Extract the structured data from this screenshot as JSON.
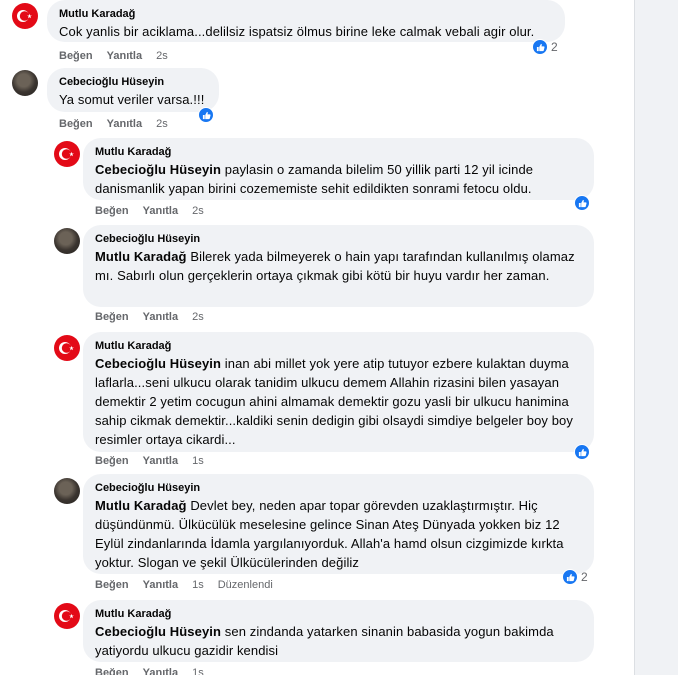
{
  "actions": {
    "like": "Beğen",
    "reply": "Yanıtla"
  },
  "comments": [
    {
      "author": "Mutlu Karadağ",
      "mention": "",
      "text": "Cok yanlis bir aciklama...delilsiz ispatsiz ölmus birine leke calmak vebali agir olur.",
      "time": "2s",
      "edited": "",
      "reactions": "2",
      "avatar": "flag"
    },
    {
      "author": "Cebecioğlu Hüseyin",
      "mention": "",
      "text": "Ya somut veriler varsa.!!!",
      "time": "2s",
      "edited": "",
      "reactions": "",
      "avatar": "photo"
    },
    {
      "author": "Mutlu Karadağ",
      "mention": "Cebecioğlu Hüseyin",
      "text": "paylasin o zamanda bilelim 50 yillik parti 12 yil icinde danismanlik yapan birini cozememiste sehit edildikten sonrami fetocu oldu.",
      "time": "2s",
      "edited": "",
      "reactions": "",
      "avatar": "flag"
    },
    {
      "author": "Cebecioğlu Hüseyin",
      "mention": "Mutlu Karadağ",
      "text": "Bilerek yada bilmeyerek o hain yapı tarafından kullanılmış olamaz mı. Sabırlı olun gerçeklerin ortaya çıkmak gibi kötü bir huyu vardır her zaman.",
      "time": "2s",
      "edited": "",
      "reactions": "",
      "avatar": "photo"
    },
    {
      "author": "Mutlu Karadağ",
      "mention": "Cebecioğlu Hüseyin",
      "text": "inan abi millet yok yere atip tutuyor ezbere kulaktan duyma laflarla...seni ulkucu olarak tanidim ulkucu demem Allahin rizasini bilen yasayan demektir 2 yetim cocugun ahini almamak demektir gozu yasli bir ulkucu hanimina sahip cikmak demektir...kaldiki senin dedigin gibi olsaydi simdiye belgeler boy boy resimler ortaya cikardi...",
      "time": "1s",
      "edited": "",
      "reactions": "",
      "avatar": "flag"
    },
    {
      "author": "Cebecioğlu Hüseyin",
      "mention": "Mutlu Karadağ",
      "text": "Devlet bey, neden apar topar görevden uzaklaştırmıştır. Hiç düşündünmü. Ülkücülük meselesine gelince Sinan Ateş Dünyada yokken biz 12 Eylül zindanlarında İdamla yargılanıyorduk. Allah'a hamd olsun cizgimizde kırkta yoktur. Slogan ve şekil Ülkücülerinden değiliz",
      "time": "1s",
      "edited": "Düzenlendi",
      "reactions": "2",
      "avatar": "photo"
    },
    {
      "author": "Mutlu Karadağ",
      "mention": "Cebecioğlu Hüseyin",
      "text": "sen zindanda yatarken sinanin babasida yogun bakimda yatiyordu ulkucu gazidir kendisi",
      "time": "1s",
      "edited": "",
      "reactions": "",
      "avatar": "flag"
    }
  ]
}
